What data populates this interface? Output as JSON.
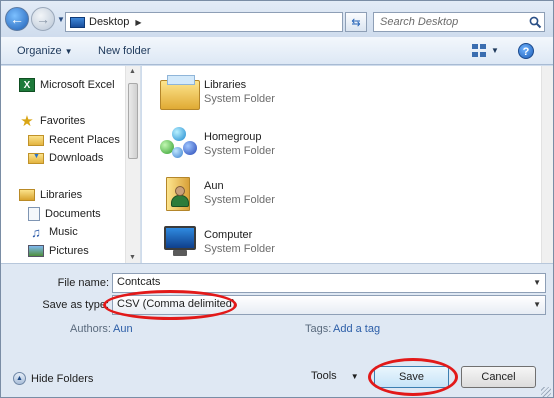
{
  "address_bar": {
    "location": "Desktop",
    "search_placeholder": "Search Desktop"
  },
  "toolbar": {
    "organize_label": "Organize",
    "new_folder_label": "New folder"
  },
  "nav_pane": {
    "items": [
      {
        "label": "Microsoft Excel",
        "icon": "excel-icon"
      },
      {
        "label": "Favorites",
        "icon": "star-icon"
      },
      {
        "label": "Recent Places",
        "icon": "recent-places-icon"
      },
      {
        "label": "Downloads",
        "icon": "downloads-icon"
      },
      {
        "label": "Libraries",
        "icon": "libraries-icon"
      },
      {
        "label": "Documents",
        "icon": "documents-icon"
      },
      {
        "label": "Music",
        "icon": "music-icon"
      },
      {
        "label": "Pictures",
        "icon": "pictures-icon"
      }
    ]
  },
  "content": {
    "items": [
      {
        "name": "Libraries",
        "type": "System Folder",
        "icon": "libraries-folder-icon"
      },
      {
        "name": "Homegroup",
        "type": "System Folder",
        "icon": "homegroup-icon"
      },
      {
        "name": "Aun",
        "type": "System Folder",
        "icon": "user-folder-icon"
      },
      {
        "name": "Computer",
        "type": "System Folder",
        "icon": "computer-icon"
      }
    ]
  },
  "form": {
    "file_name_label": "File name:",
    "file_name_value": "Contcats",
    "save_as_type_label": "Save as type:",
    "save_as_type_value": "CSV (Comma delimited)",
    "authors_label": "Authors:",
    "authors_value": "Aun",
    "tags_label": "Tags:",
    "tags_value": "Add a tag"
  },
  "footer": {
    "hide_folders_label": "Hide Folders",
    "tools_label": "Tools",
    "save_label": "Save",
    "cancel_label": "Cancel"
  },
  "colors": {
    "highlight_oval": "#e21919",
    "link": "#2c5ea8"
  }
}
